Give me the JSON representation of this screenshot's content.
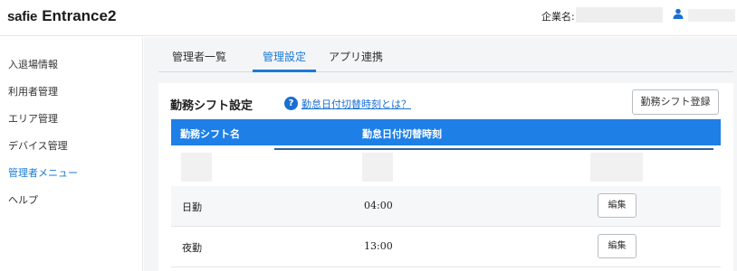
{
  "header": {
    "brand": "safie",
    "product": "Entrance2",
    "company_label": "企業名:"
  },
  "sidebar": {
    "items": [
      {
        "label": "入退場情報",
        "active": false
      },
      {
        "label": "利用者管理",
        "active": false
      },
      {
        "label": "エリア管理",
        "active": false
      },
      {
        "label": "デバイス管理",
        "active": false
      },
      {
        "label": "管理者メニュー",
        "active": true
      },
      {
        "label": "ヘルプ",
        "active": false
      }
    ]
  },
  "tabs": [
    {
      "label": "管理者一覧",
      "active": false
    },
    {
      "label": "管理設定",
      "active": true
    },
    {
      "label": "アプリ連携",
      "active": false
    }
  ],
  "section": {
    "title": "勤務シフト設定",
    "help_link": "勤怠日付切替時刻とは？",
    "register_button": "勤務シフト登録"
  },
  "table": {
    "columns": [
      "勤務シフト名",
      "勤怠日付切替時刻"
    ],
    "rows": [
      {
        "name": "日勤",
        "time": "04:00",
        "action": "編集"
      },
      {
        "name": "夜勤",
        "time": "13:00",
        "action": "編集"
      }
    ]
  },
  "colors": {
    "accent": "#1a7ad6",
    "table_header": "#1e7fe6",
    "main_bg": "#f4f5f7"
  }
}
